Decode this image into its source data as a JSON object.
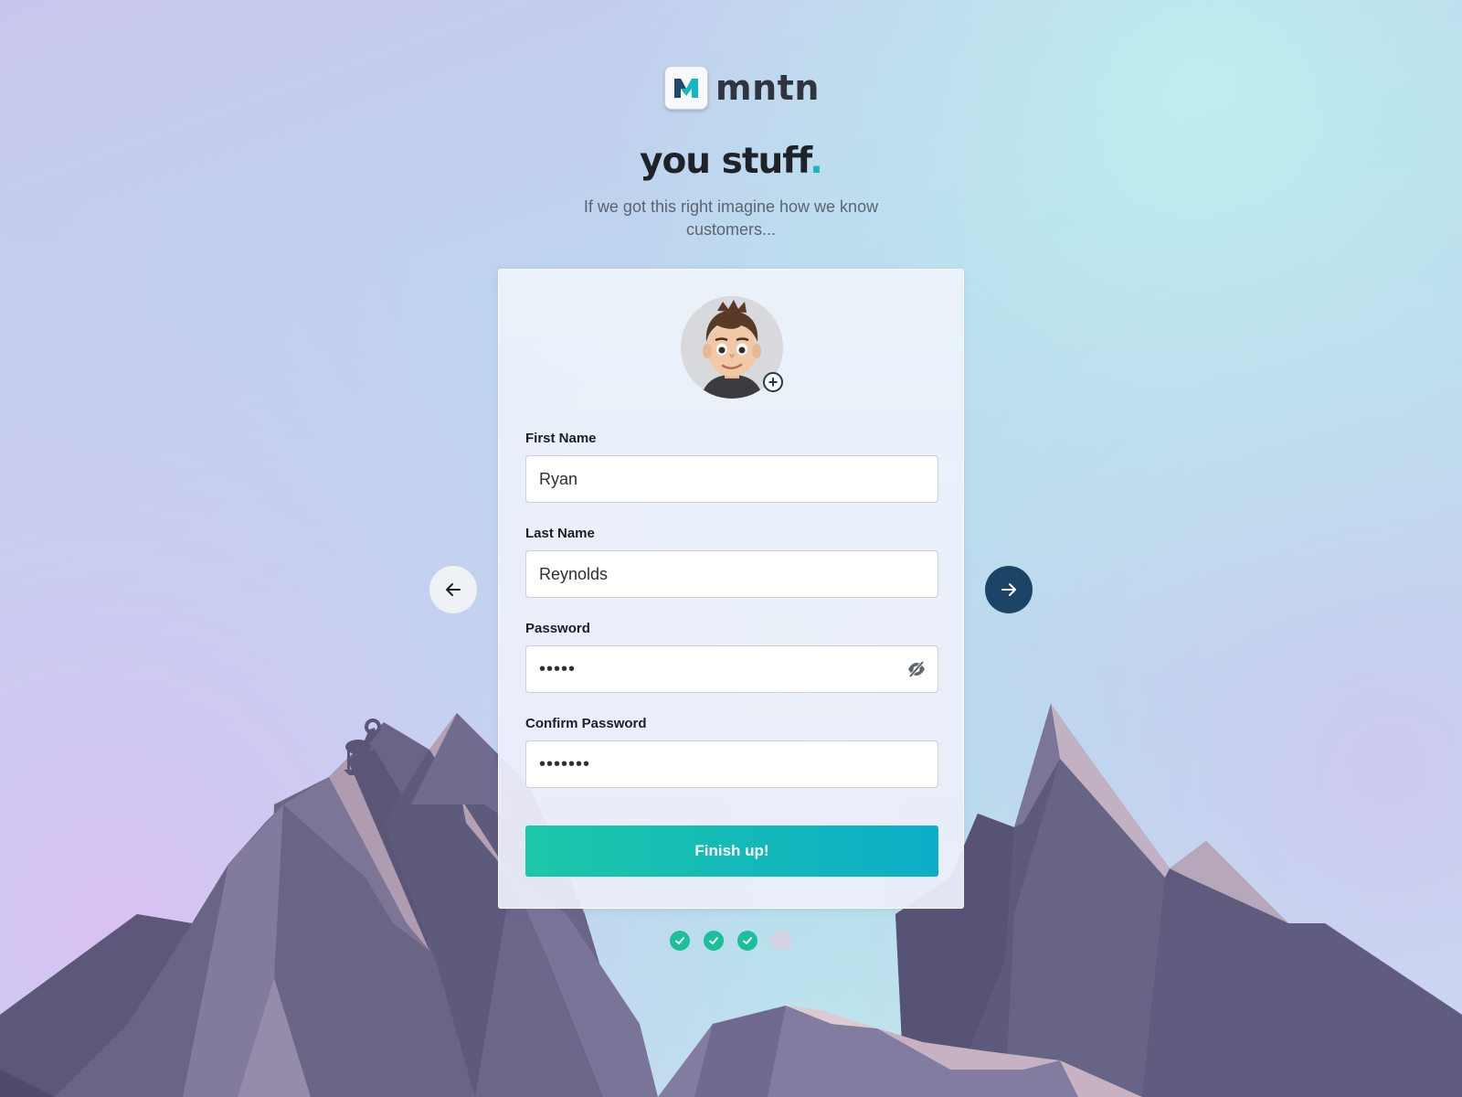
{
  "brand": {
    "name": "mntn"
  },
  "header": {
    "title": "you stuff",
    "title_accent": ".",
    "subtitle": "If we got this right imagine how we know customers..."
  },
  "form": {
    "first_name": {
      "label": "First Name",
      "value": "Ryan"
    },
    "last_name": {
      "label": "Last Name",
      "value": "Reynolds"
    },
    "password": {
      "label": "Password",
      "value": "•••••"
    },
    "confirm_password": {
      "label": "Confirm Password",
      "value": "•••••••"
    },
    "submit_label": "Finish up!"
  },
  "steps": [
    {
      "state": "done"
    },
    {
      "state": "done"
    },
    {
      "state": "done"
    },
    {
      "state": "pending"
    }
  ],
  "icons": {
    "avatar_add": "plus-circle-icon",
    "password_toggle": "eye-off-icon",
    "prev": "arrow-left-icon",
    "next": "arrow-right-icon",
    "step_done": "check-icon"
  },
  "colors": {
    "accent": "#16b6c2",
    "button_start": "#1cc7a8",
    "button_end": "#0caec8",
    "next_button": "#1b4467",
    "step_done": "#1dbe9c"
  }
}
